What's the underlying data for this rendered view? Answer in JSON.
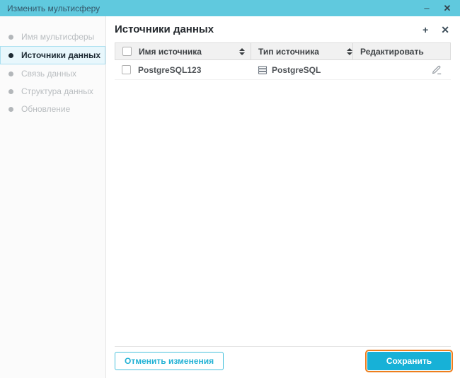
{
  "window": {
    "title": "Изменить мультисферу",
    "minimize_label": "–",
    "close_label": "✕"
  },
  "sidebar": {
    "items": [
      {
        "label": "Имя мультисферы",
        "active": false
      },
      {
        "label": "Источники данных",
        "active": true
      },
      {
        "label": "Связь данных",
        "active": false
      },
      {
        "label": "Структура данных",
        "active": false
      },
      {
        "label": "Обновление",
        "active": false
      }
    ]
  },
  "panel": {
    "title": "Источники данных",
    "add_label": "+",
    "close_label": "✕"
  },
  "table": {
    "columns": {
      "name": "Имя источника",
      "type": "Тип источника",
      "edit": "Редактировать"
    },
    "rows": [
      {
        "name": "PostgreSQL123",
        "type": "PostgreSQL",
        "checked": false
      }
    ]
  },
  "footer": {
    "cancel_label": "Отменить изменения",
    "save_label": "Сохранить"
  },
  "colors": {
    "titlebar": "#60c9de",
    "accent": "#17b1d7",
    "active_item_bg": "#e8f7fc",
    "active_item_border": "#aadff0",
    "save_highlight_outline": "#ee7e1d",
    "table_header_bg": "#f1f1f1"
  }
}
